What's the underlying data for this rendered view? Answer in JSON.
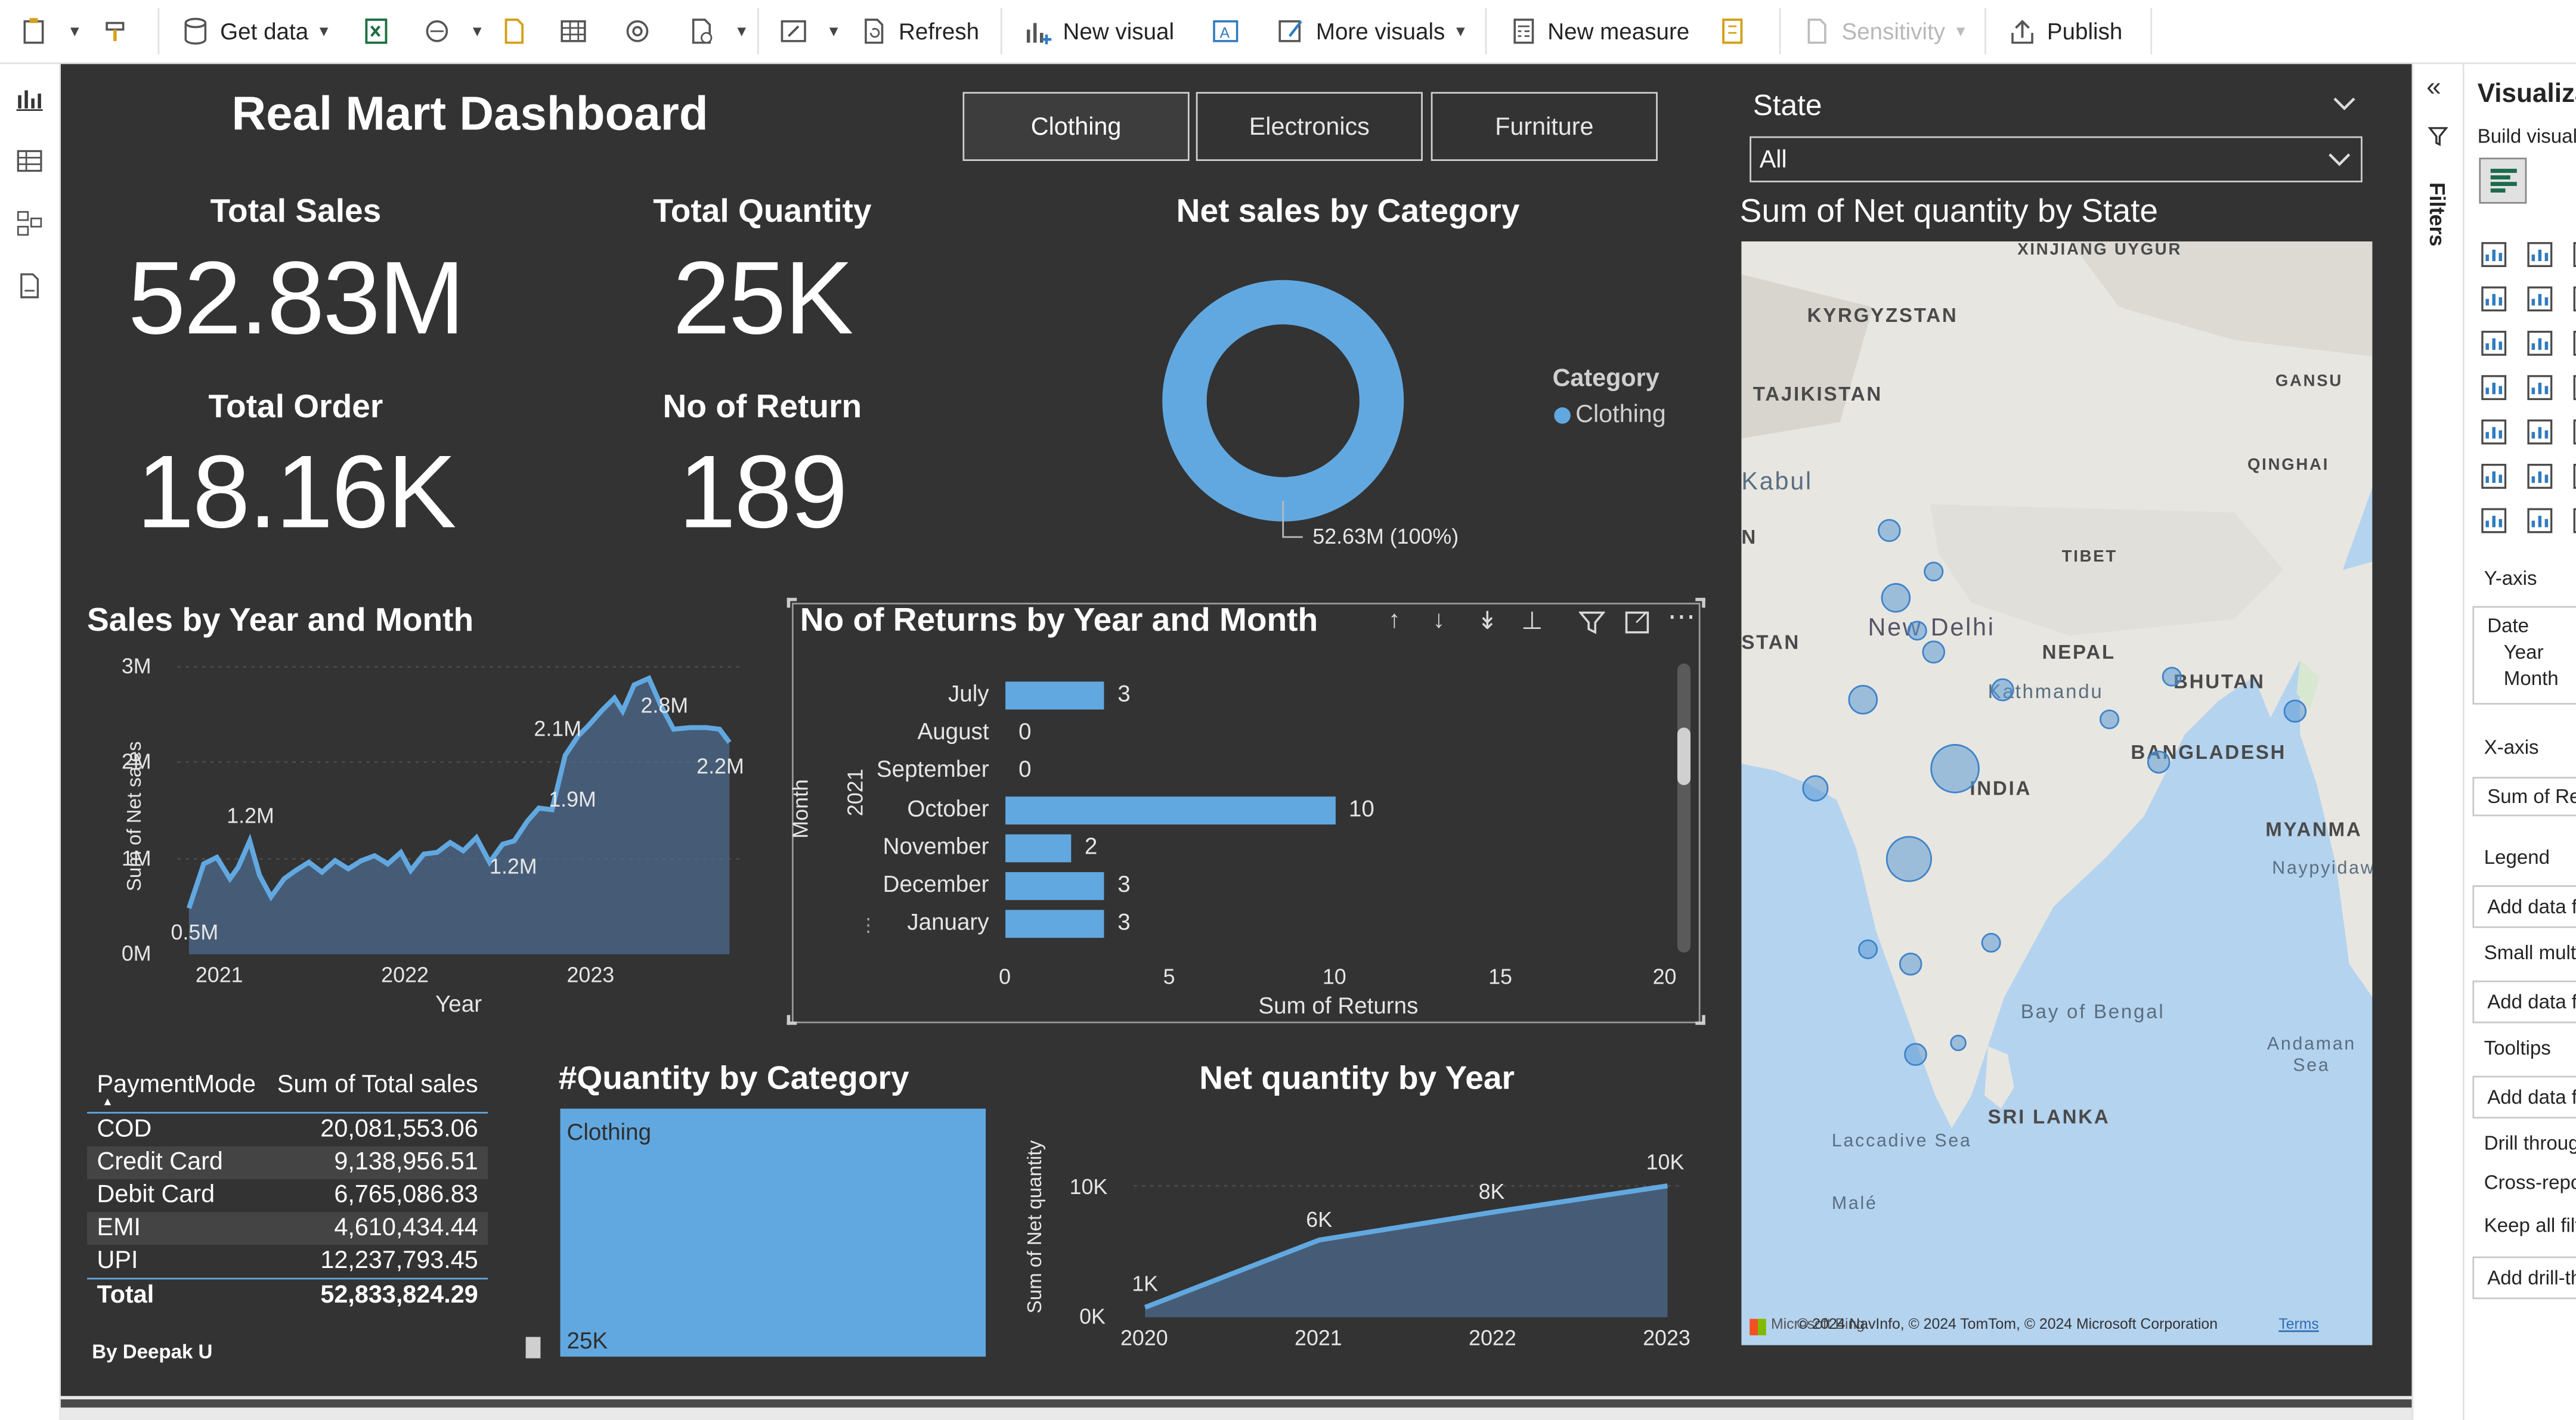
{
  "ribbon": {
    "get_data": "Get data",
    "refresh": "Refresh",
    "new_visual": "New visual",
    "more_visuals": "More visuals",
    "new_measure": "New measure",
    "sensitivity": "Sensitivity",
    "publish": "Publish"
  },
  "dashboard": {
    "title": "Real Mart Dashboard",
    "author": "By Deepak U"
  },
  "category_slicer": [
    "Clothing",
    "Electronics",
    "Furniture"
  ],
  "state_slicer": {
    "label": "State",
    "value": "All"
  },
  "kpis": {
    "total_sales_label": "Total Sales",
    "total_sales": "52.83M",
    "total_quantity_label": "Total Quantity",
    "total_quantity": "25K",
    "total_order_label": "Total Order",
    "total_order": "18.16K",
    "returns_label": "No of Return",
    "returns": "189"
  },
  "donut": {
    "title": "Net sales by Category",
    "legend_title": "Category",
    "legend_item": "Clothing",
    "label": "52.63M (100%)",
    "color": "#62a8e0"
  },
  "sales_chart": {
    "title": "Sales by Year and Month",
    "y_ticks": [
      "3M",
      "2M",
      "1M",
      "0M"
    ],
    "x_ticks": [
      "2021",
      "2022",
      "2023"
    ],
    "xlabel": "Year",
    "ylabel": "Sum of Net sales",
    "annotations": [
      "1.2M",
      "0.5M",
      "2.1M",
      "2.8M",
      "1.9M",
      "1.2M",
      "2.2M"
    ]
  },
  "returns_chart": {
    "title": "No of Returns by Year and Month",
    "year": "2021",
    "axis_title": "Month",
    "xlabel": "Sum of Returns",
    "x_ticks": [
      "0",
      "5",
      "10",
      "15",
      "20"
    ],
    "months": [
      "July",
      "August",
      "September",
      "October",
      "November",
      "December",
      "January"
    ],
    "values": [
      "3",
      "0",
      "0",
      "10",
      "2",
      "3",
      "3"
    ]
  },
  "payment_table": {
    "col1": "PaymentMode",
    "col2": "Sum of Total sales",
    "rows": [
      {
        "mode": "COD",
        "value": "20,081,553.06"
      },
      {
        "mode": "Credit Card",
        "value": "9,138,956.51"
      },
      {
        "mode": "Debit Card",
        "value": "6,765,086.83"
      },
      {
        "mode": "EMI",
        "value": "4,610,434.44"
      },
      {
        "mode": "UPI",
        "value": "12,237,793.45"
      }
    ],
    "total_label": "Total",
    "total_value": "52,833,824.29"
  },
  "treemap": {
    "title": "#Quantity by Category",
    "category": "Clothing",
    "value": "25K"
  },
  "net_qty_chart": {
    "title": "Net quantity by Year",
    "ylabel": "Sum of Net quantity",
    "y_ticks": [
      "10K",
      "0K"
    ],
    "x_ticks": [
      "2020",
      "2021",
      "2022",
      "2023"
    ],
    "labels": [
      "1K",
      "6K",
      "8K",
      "10K"
    ]
  },
  "map": {
    "title": "Sum of Net quantity by State",
    "labels": {
      "xinjiang": "XINJIANG UYGUR",
      "kyrgyzstan": "KYRGYZSTAN",
      "tajikistan": "TAJIKISTAN",
      "gansu": "GANSU",
      "kabul": "Kabul",
      "qinghai": "QINGHAI",
      "tibet": "TIBET",
      "stan": "STAN",
      "new_delhi": "New Delhi",
      "nepal": "NEPAL",
      "kathmandu": "Kathmandu",
      "bhutan": "BHUTAN",
      "bangladesh": "BANGLADESH",
      "india": "INDIA",
      "myanmar": "MYANMA",
      "naypyidaw": "Naypyidaw",
      "bay_of_bengal": "Bay of Bengal",
      "andaman_sea": "Andaman Sea",
      "sri_lanka": "SRI LANKA",
      "laccadive_sea": "Laccadive Sea",
      "male": "Malé",
      "n": "N"
    },
    "attribution": "© 2024 NavInfo, © 2024 TomTom, © 2024 Microsoft Corporation",
    "terms": "Terms",
    "bing": "Microsoft Bing"
  },
  "filters_tab": "Filters",
  "viz_pane": {
    "title": "Visualiza",
    "build": "Build visual",
    "y_axis": "Y-axis",
    "date": "Date",
    "year": "Year",
    "month": "Month",
    "x_axis": "X-axis",
    "x_field": "Sum of Retu",
    "legend": "Legend",
    "add_data": "Add data f",
    "small_multiples": "Small multi",
    "tooltips": "Tooltips",
    "drill_through": "Drill throug",
    "cross_report": "Cross-repo",
    "keep_filters": "Keep all filt",
    "add_drill": "Add drill-th"
  }
}
